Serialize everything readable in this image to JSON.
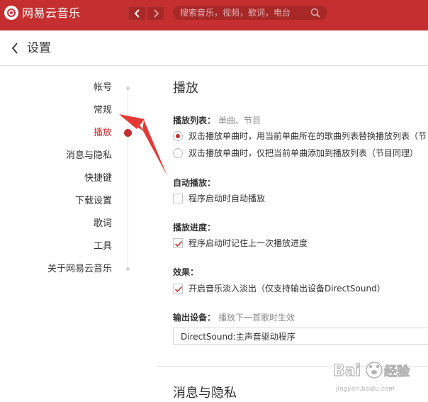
{
  "app": {
    "title": "网易云音乐",
    "accent_color": "#c62f2f"
  },
  "titlebar": {
    "back_icon": "chevron-left-icon",
    "forward_icon": "chevron-right-icon",
    "search_placeholder": "搜索音乐，视频，歌词，电台",
    "search_icon": "search-icon"
  },
  "header": {
    "back_icon": "chevron-left-icon",
    "title": "设置"
  },
  "sidebar": {
    "items": [
      {
        "label": "帐号",
        "active": false
      },
      {
        "label": "常规",
        "active": false
      },
      {
        "label": "播放",
        "active": true
      },
      {
        "label": "消息与隐私",
        "active": false
      },
      {
        "label": "快捷键",
        "active": false
      },
      {
        "label": "下载设置",
        "active": false
      },
      {
        "label": "歌词",
        "active": false
      },
      {
        "label": "工具",
        "active": false
      },
      {
        "label": "关于网易云音乐",
        "active": false
      }
    ]
  },
  "playback": {
    "section_title": "播放",
    "playlist": {
      "label": "播放列表：",
      "hint": "单曲、节目",
      "options": [
        {
          "text": "双击播放单曲时，用当前单曲所在的歌曲列表替换播放列表（节",
          "checked": true
        },
        {
          "text": "双击播放单曲时，仅把当前单曲添加到播放列表（节目同理）",
          "checked": false
        }
      ]
    },
    "autoplay": {
      "label": "自动播放：",
      "option": {
        "text": "程序启动时自动播放",
        "checked": false
      }
    },
    "progress": {
      "label": "播放进度：",
      "option": {
        "text": "程序启动时记住上一次播放进度",
        "checked": true
      }
    },
    "effects": {
      "label": "效果：",
      "option": {
        "text": "开启音乐淡入淡出（仅支持输出设备DirectSound）",
        "checked": true
      }
    },
    "output": {
      "label": "输出设备：",
      "hint": "播放下一首歌时生效",
      "selected": "DirectSound:主声音驱动程序"
    }
  },
  "next_section": {
    "title": "消息与隐私"
  },
  "watermark": {
    "text": "Bai du 经验",
    "url": "jingyan.baidu.com"
  }
}
